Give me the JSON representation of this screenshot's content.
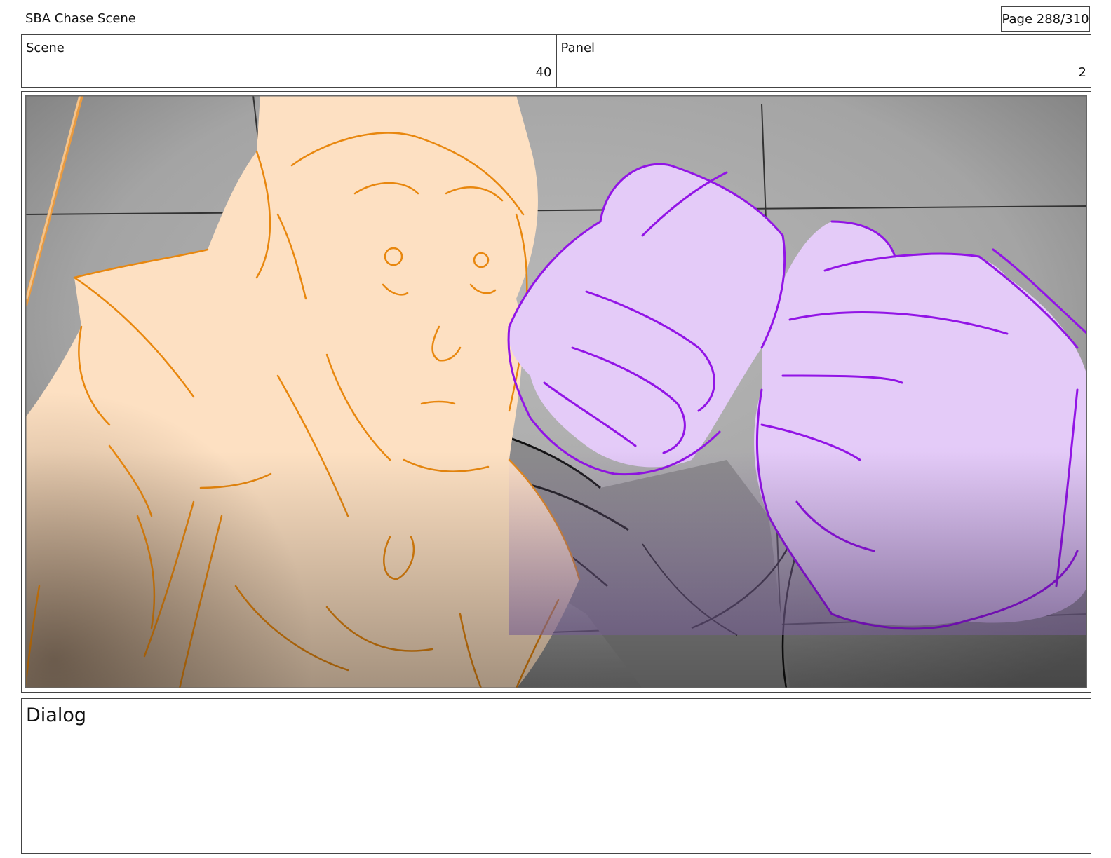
{
  "header": {
    "title": "SBA Chase Scene",
    "page": "Page 288/310"
  },
  "info": {
    "scene": {
      "label": "Scene",
      "value": "40"
    },
    "panel": {
      "label": "Panel",
      "value": "2"
    }
  },
  "dialog": {
    "label": "Dialog"
  }
}
